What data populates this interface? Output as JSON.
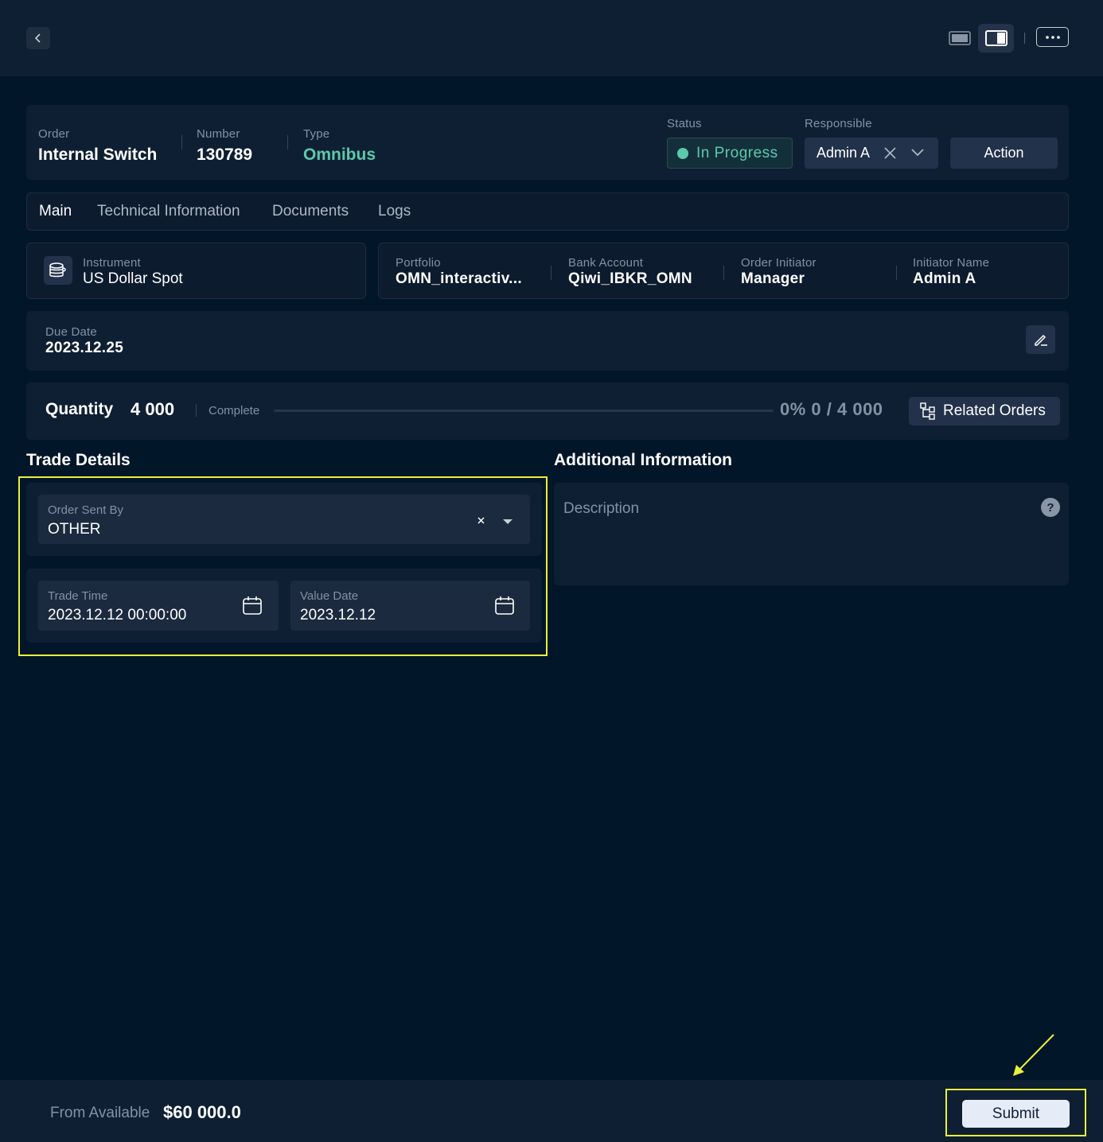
{
  "colors": {
    "background": "#02162a",
    "panel": "#0f1f33",
    "accent": "#5cc9ac",
    "highlight": "#e9f03a",
    "submit": "#e6ebf8"
  },
  "topbar": {
    "back_icon": "chevron-left-icon",
    "view_icons": [
      "single-panel-icon",
      "split-panel-icon"
    ],
    "more_icon": "ellipsis-icon"
  },
  "header": {
    "order_label": "Order",
    "order_value": "Internal Switch",
    "number_label": "Number",
    "number_value": "130789",
    "type_label": "Type",
    "type_value": "Omnibus",
    "status_label": "Status",
    "status_value": "In Progress",
    "responsible_label": "Responsible",
    "responsible_value": "Admin A",
    "action_label": "Action"
  },
  "tabs": [
    {
      "label": "Main",
      "active": true
    },
    {
      "label": "Technical Information",
      "active": false
    },
    {
      "label": "Documents",
      "active": false
    },
    {
      "label": "Logs",
      "active": false
    }
  ],
  "instrument": {
    "label": "Instrument",
    "value": "US Dollar Spot",
    "icon": "coins-icon"
  },
  "details": {
    "portfolio_label": "Portfolio",
    "portfolio_value": "OMN_interactiv...",
    "bank_label": "Bank Account",
    "bank_value": "Qiwi_IBKR_OMN",
    "initiator_label": "Order Initiator",
    "initiator_value": "Manager",
    "initiator_name_label": "Initiator Name",
    "initiator_name_value": "Admin A"
  },
  "due_date": {
    "label": "Due Date",
    "value": "2023.12.25",
    "icon": "edit-icon"
  },
  "quantity": {
    "label": "Quantity",
    "value": "4 000",
    "complete_label": "Complete",
    "progress_fraction": 0,
    "progress_text": "0% 0 / 4 000",
    "related_label": "Related Orders"
  },
  "trade_details": {
    "title": "Trade Details",
    "order_sent_by_label": "Order Sent By",
    "order_sent_by_value": "OTHER",
    "trade_time_label": "Trade Time",
    "trade_time_value": "2023.12.12 00:00:00",
    "value_date_label": "Value Date",
    "value_date_value": "2023.12.12"
  },
  "additional": {
    "title": "Additional Information",
    "description_placeholder": "Description",
    "help_icon_text": "?"
  },
  "footer": {
    "from_label": "From Available",
    "from_value": "$60 000.0",
    "submit_label": "Submit"
  }
}
